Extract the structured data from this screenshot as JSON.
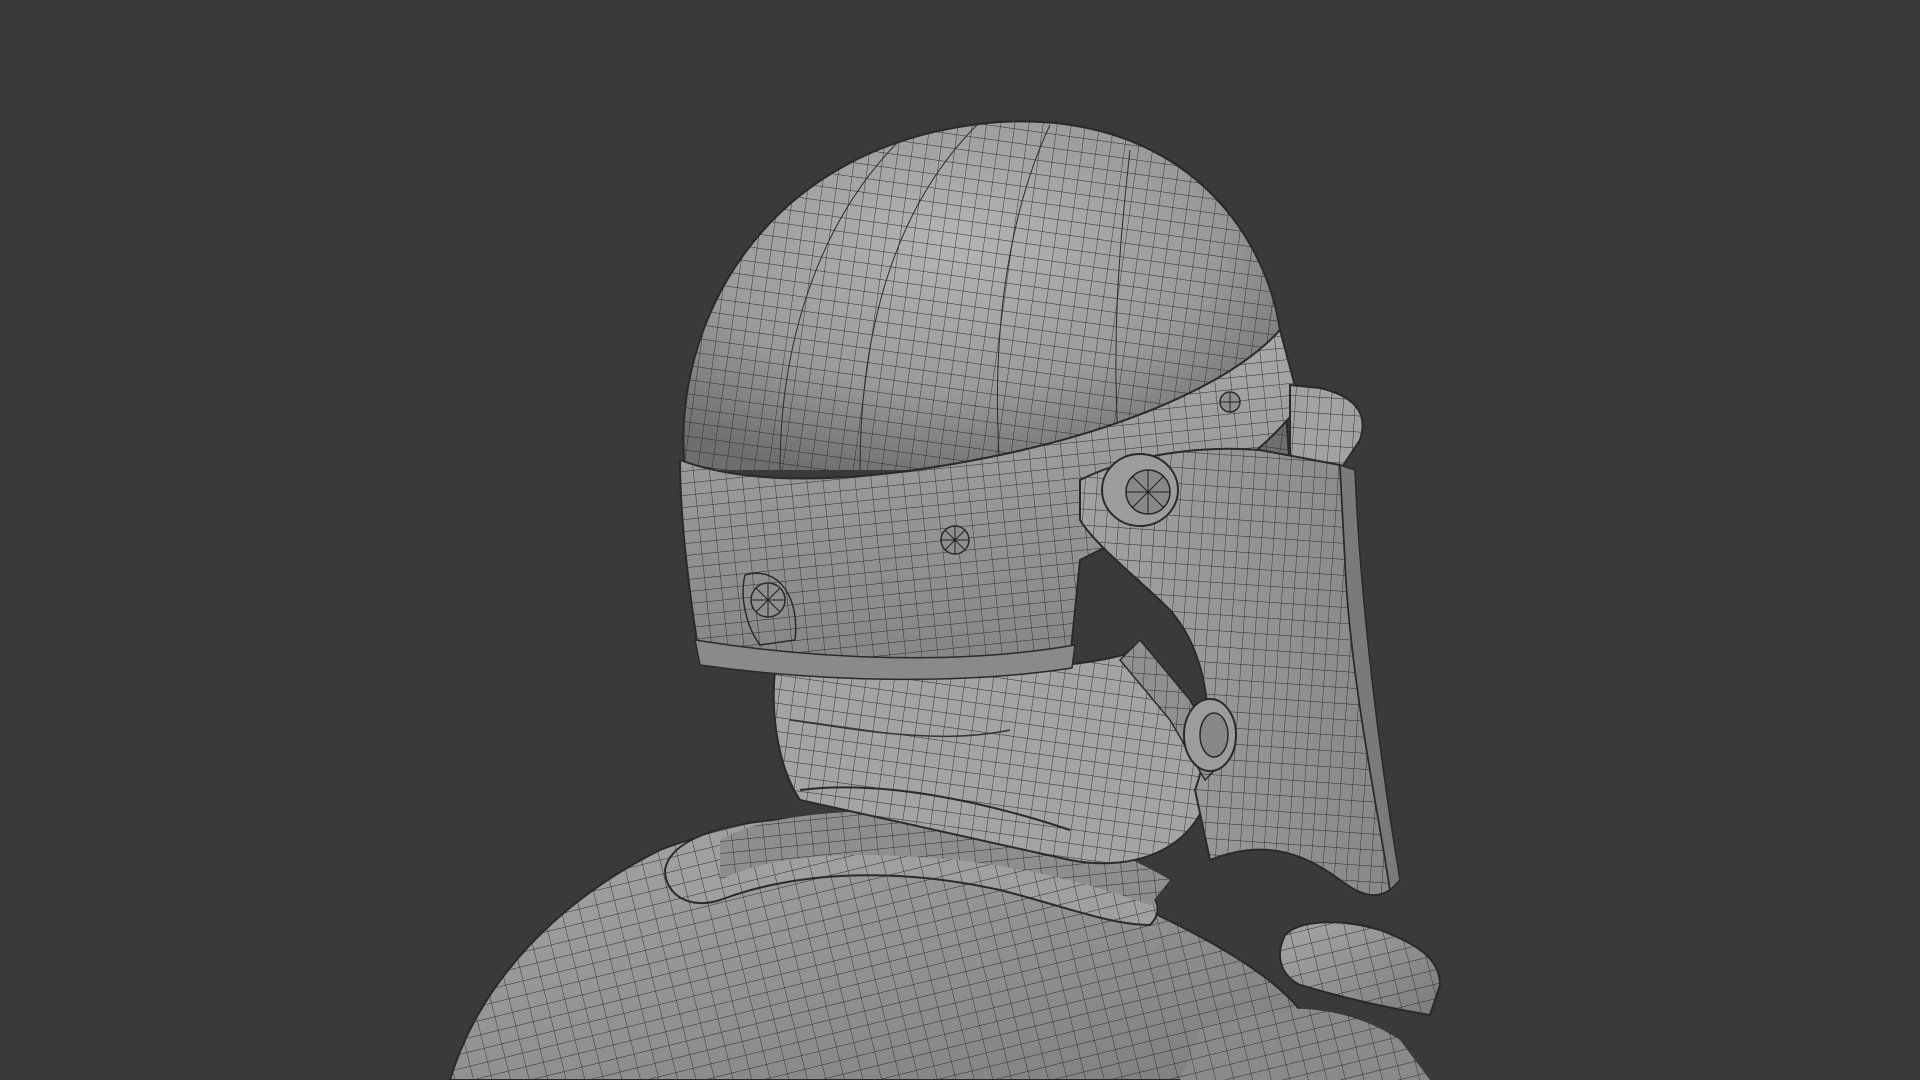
{
  "viewport": {
    "background_color": "#3a3a3a",
    "mesh_surface_color": "#9a9a9a",
    "wireframe_color": "#2a2a2a",
    "display_mode": "wireframe-overlay",
    "subject": "helmeted-figure-mesh"
  }
}
